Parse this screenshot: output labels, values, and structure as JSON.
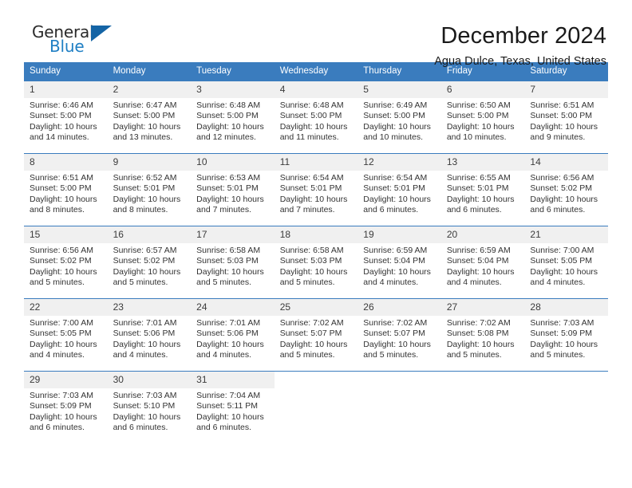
{
  "brand": {
    "name_top": "General",
    "name_bottom": "Blue",
    "accent_color": "#1464a5",
    "text_color": "#2b2b2b"
  },
  "header": {
    "title": "December 2024",
    "location": "Agua Dulce, Texas, United States"
  },
  "calendar": {
    "header_bg": "#3a7cbe",
    "day_number_bg": "#f0f0f0",
    "weekdays": [
      "Sunday",
      "Monday",
      "Tuesday",
      "Wednesday",
      "Thursday",
      "Friday",
      "Saturday"
    ],
    "weeks": [
      [
        {
          "day": "1",
          "sunrise": "Sunrise: 6:46 AM",
          "sunset": "Sunset: 5:00 PM",
          "daylight_1": "Daylight: 10 hours",
          "daylight_2": "and 14 minutes."
        },
        {
          "day": "2",
          "sunrise": "Sunrise: 6:47 AM",
          "sunset": "Sunset: 5:00 PM",
          "daylight_1": "Daylight: 10 hours",
          "daylight_2": "and 13 minutes."
        },
        {
          "day": "3",
          "sunrise": "Sunrise: 6:48 AM",
          "sunset": "Sunset: 5:00 PM",
          "daylight_1": "Daylight: 10 hours",
          "daylight_2": "and 12 minutes."
        },
        {
          "day": "4",
          "sunrise": "Sunrise: 6:48 AM",
          "sunset": "Sunset: 5:00 PM",
          "daylight_1": "Daylight: 10 hours",
          "daylight_2": "and 11 minutes."
        },
        {
          "day": "5",
          "sunrise": "Sunrise: 6:49 AM",
          "sunset": "Sunset: 5:00 PM",
          "daylight_1": "Daylight: 10 hours",
          "daylight_2": "and 10 minutes."
        },
        {
          "day": "6",
          "sunrise": "Sunrise: 6:50 AM",
          "sunset": "Sunset: 5:00 PM",
          "daylight_1": "Daylight: 10 hours",
          "daylight_2": "and 10 minutes."
        },
        {
          "day": "7",
          "sunrise": "Sunrise: 6:51 AM",
          "sunset": "Sunset: 5:00 PM",
          "daylight_1": "Daylight: 10 hours",
          "daylight_2": "and 9 minutes."
        }
      ],
      [
        {
          "day": "8",
          "sunrise": "Sunrise: 6:51 AM",
          "sunset": "Sunset: 5:00 PM",
          "daylight_1": "Daylight: 10 hours",
          "daylight_2": "and 8 minutes."
        },
        {
          "day": "9",
          "sunrise": "Sunrise: 6:52 AM",
          "sunset": "Sunset: 5:01 PM",
          "daylight_1": "Daylight: 10 hours",
          "daylight_2": "and 8 minutes."
        },
        {
          "day": "10",
          "sunrise": "Sunrise: 6:53 AM",
          "sunset": "Sunset: 5:01 PM",
          "daylight_1": "Daylight: 10 hours",
          "daylight_2": "and 7 minutes."
        },
        {
          "day": "11",
          "sunrise": "Sunrise: 6:54 AM",
          "sunset": "Sunset: 5:01 PM",
          "daylight_1": "Daylight: 10 hours",
          "daylight_2": "and 7 minutes."
        },
        {
          "day": "12",
          "sunrise": "Sunrise: 6:54 AM",
          "sunset": "Sunset: 5:01 PM",
          "daylight_1": "Daylight: 10 hours",
          "daylight_2": "and 6 minutes."
        },
        {
          "day": "13",
          "sunrise": "Sunrise: 6:55 AM",
          "sunset": "Sunset: 5:01 PM",
          "daylight_1": "Daylight: 10 hours",
          "daylight_2": "and 6 minutes."
        },
        {
          "day": "14",
          "sunrise": "Sunrise: 6:56 AM",
          "sunset": "Sunset: 5:02 PM",
          "daylight_1": "Daylight: 10 hours",
          "daylight_2": "and 6 minutes."
        }
      ],
      [
        {
          "day": "15",
          "sunrise": "Sunrise: 6:56 AM",
          "sunset": "Sunset: 5:02 PM",
          "daylight_1": "Daylight: 10 hours",
          "daylight_2": "and 5 minutes."
        },
        {
          "day": "16",
          "sunrise": "Sunrise: 6:57 AM",
          "sunset": "Sunset: 5:02 PM",
          "daylight_1": "Daylight: 10 hours",
          "daylight_2": "and 5 minutes."
        },
        {
          "day": "17",
          "sunrise": "Sunrise: 6:58 AM",
          "sunset": "Sunset: 5:03 PM",
          "daylight_1": "Daylight: 10 hours",
          "daylight_2": "and 5 minutes."
        },
        {
          "day": "18",
          "sunrise": "Sunrise: 6:58 AM",
          "sunset": "Sunset: 5:03 PM",
          "daylight_1": "Daylight: 10 hours",
          "daylight_2": "and 5 minutes."
        },
        {
          "day": "19",
          "sunrise": "Sunrise: 6:59 AM",
          "sunset": "Sunset: 5:04 PM",
          "daylight_1": "Daylight: 10 hours",
          "daylight_2": "and 4 minutes."
        },
        {
          "day": "20",
          "sunrise": "Sunrise: 6:59 AM",
          "sunset": "Sunset: 5:04 PM",
          "daylight_1": "Daylight: 10 hours",
          "daylight_2": "and 4 minutes."
        },
        {
          "day": "21",
          "sunrise": "Sunrise: 7:00 AM",
          "sunset": "Sunset: 5:05 PM",
          "daylight_1": "Daylight: 10 hours",
          "daylight_2": "and 4 minutes."
        }
      ],
      [
        {
          "day": "22",
          "sunrise": "Sunrise: 7:00 AM",
          "sunset": "Sunset: 5:05 PM",
          "daylight_1": "Daylight: 10 hours",
          "daylight_2": "and 4 minutes."
        },
        {
          "day": "23",
          "sunrise": "Sunrise: 7:01 AM",
          "sunset": "Sunset: 5:06 PM",
          "daylight_1": "Daylight: 10 hours",
          "daylight_2": "and 4 minutes."
        },
        {
          "day": "24",
          "sunrise": "Sunrise: 7:01 AM",
          "sunset": "Sunset: 5:06 PM",
          "daylight_1": "Daylight: 10 hours",
          "daylight_2": "and 4 minutes."
        },
        {
          "day": "25",
          "sunrise": "Sunrise: 7:02 AM",
          "sunset": "Sunset: 5:07 PM",
          "daylight_1": "Daylight: 10 hours",
          "daylight_2": "and 5 minutes."
        },
        {
          "day": "26",
          "sunrise": "Sunrise: 7:02 AM",
          "sunset": "Sunset: 5:07 PM",
          "daylight_1": "Daylight: 10 hours",
          "daylight_2": "and 5 minutes."
        },
        {
          "day": "27",
          "sunrise": "Sunrise: 7:02 AM",
          "sunset": "Sunset: 5:08 PM",
          "daylight_1": "Daylight: 10 hours",
          "daylight_2": "and 5 minutes."
        },
        {
          "day": "28",
          "sunrise": "Sunrise: 7:03 AM",
          "sunset": "Sunset: 5:09 PM",
          "daylight_1": "Daylight: 10 hours",
          "daylight_2": "and 5 minutes."
        }
      ],
      [
        {
          "day": "29",
          "sunrise": "Sunrise: 7:03 AM",
          "sunset": "Sunset: 5:09 PM",
          "daylight_1": "Daylight: 10 hours",
          "daylight_2": "and 6 minutes."
        },
        {
          "day": "30",
          "sunrise": "Sunrise: 7:03 AM",
          "sunset": "Sunset: 5:10 PM",
          "daylight_1": "Daylight: 10 hours",
          "daylight_2": "and 6 minutes."
        },
        {
          "day": "31",
          "sunrise": "Sunrise: 7:04 AM",
          "sunset": "Sunset: 5:11 PM",
          "daylight_1": "Daylight: 10 hours",
          "daylight_2": "and 6 minutes."
        },
        {
          "day": "",
          "sunrise": "",
          "sunset": "",
          "daylight_1": "",
          "daylight_2": ""
        },
        {
          "day": "",
          "sunrise": "",
          "sunset": "",
          "daylight_1": "",
          "daylight_2": ""
        },
        {
          "day": "",
          "sunrise": "",
          "sunset": "",
          "daylight_1": "",
          "daylight_2": ""
        },
        {
          "day": "",
          "sunrise": "",
          "sunset": "",
          "daylight_1": "",
          "daylight_2": ""
        }
      ]
    ]
  }
}
